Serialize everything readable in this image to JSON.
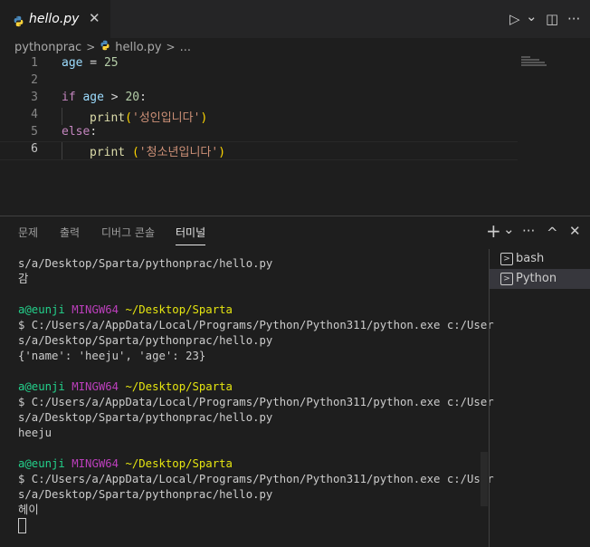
{
  "tab": {
    "file": "hello.py",
    "close_icon": "✕"
  },
  "toolbar": {
    "run_icon": "▷",
    "run_dropdown_icon": "⌄",
    "split_icon": "◫",
    "more_icon": "···"
  },
  "breadcrumb": {
    "folder": "pythonprac",
    "sep": ">",
    "file": "hello.py",
    "more": "..."
  },
  "editor": {
    "lines": [
      {
        "n": "1"
      },
      {
        "n": "2"
      },
      {
        "n": "3"
      },
      {
        "n": "4"
      },
      {
        "n": "5"
      },
      {
        "n": "6"
      }
    ],
    "code": {
      "l1": {
        "var": "age",
        "op": " = ",
        "num": "25"
      },
      "l3": {
        "kw": "if",
        "var": " age",
        "op": " > ",
        "num": "20",
        "colon": ":"
      },
      "l4": {
        "fn": "print",
        "open": "(",
        "str": "'성인입니다'",
        "close": ")"
      },
      "l5": {
        "kw": "else",
        "colon": ":"
      },
      "l6": {
        "fn": "print",
        "space": " ",
        "open": "(",
        "str": "'청소년입니다'",
        "close": ")"
      }
    }
  },
  "panel": {
    "tabs": [
      "문제",
      "출력",
      "디버그 콘솔",
      "터미널"
    ],
    "active_tab": "터미널",
    "icons": {
      "add": "+",
      "add_dropdown": "⌄",
      "more": "···",
      "maximize": "^",
      "close": "✕"
    }
  },
  "terminal": {
    "lines": [
      "s/a/Desktop/Sparta/pythonprac/hello.py",
      "감",
      "",
      {
        "user": "a@eunji",
        "host": " MINGW64 ",
        "path": "~/Desktop/Sparta"
      },
      "$ C:/Users/a/AppData/Local/Programs/Python/Python311/python.exe c:/User",
      "s/a/Desktop/Sparta/pythonprac/hello.py",
      "{'name': 'heeju', 'age': 23}",
      "",
      {
        "user": "a@eunji",
        "host": " MINGW64 ",
        "path": "~/Desktop/Sparta"
      },
      "$ C:/Users/a/AppData/Local/Programs/Python/Python311/python.exe c:/User",
      "s/a/Desktop/Sparta/pythonprac/hello.py",
      "heeju",
      "",
      {
        "user": "a@eunji",
        "host": " MINGW64 ",
        "path": "~/Desktop/Sparta"
      },
      "$ C:/Users/a/AppData/Local/Programs/Python/Python311/python.exe c:/User",
      "s/a/Desktop/Sparta/pythonprac/hello.py",
      "헤이"
    ]
  },
  "terminal_list": [
    {
      "label": "bash",
      "icon": "terminal-icon"
    },
    {
      "label": "Python",
      "icon": "terminal-icon"
    }
  ]
}
